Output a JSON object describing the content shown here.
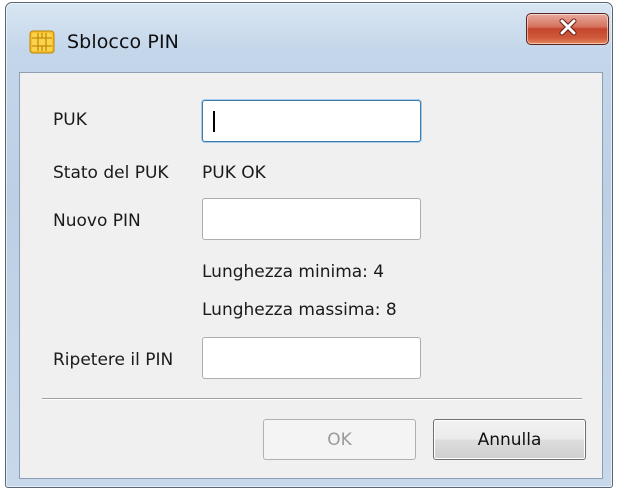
{
  "window": {
    "title": "Sblocco PIN",
    "icon": "smartcard-chip-icon",
    "close_icon": "close-icon"
  },
  "form": {
    "puk_label": "PUK",
    "puk_value": "",
    "puk_status_label": "Stato del PUK",
    "puk_status_value": "PUK OK",
    "new_pin_label": "Nuovo PIN",
    "new_pin_value": "",
    "min_length": "Lunghezza minima: 4",
    "max_length": "Lunghezza massima: 8",
    "repeat_pin_label": "Ripetere il PIN",
    "repeat_pin_value": ""
  },
  "buttons": {
    "ok_label": "OK",
    "ok_enabled": false,
    "cancel_label": "Annulla"
  },
  "colors": {
    "close_button": "#c4452c",
    "focus_border": "#3d7bad",
    "chip_icon": "#f2b51c"
  }
}
